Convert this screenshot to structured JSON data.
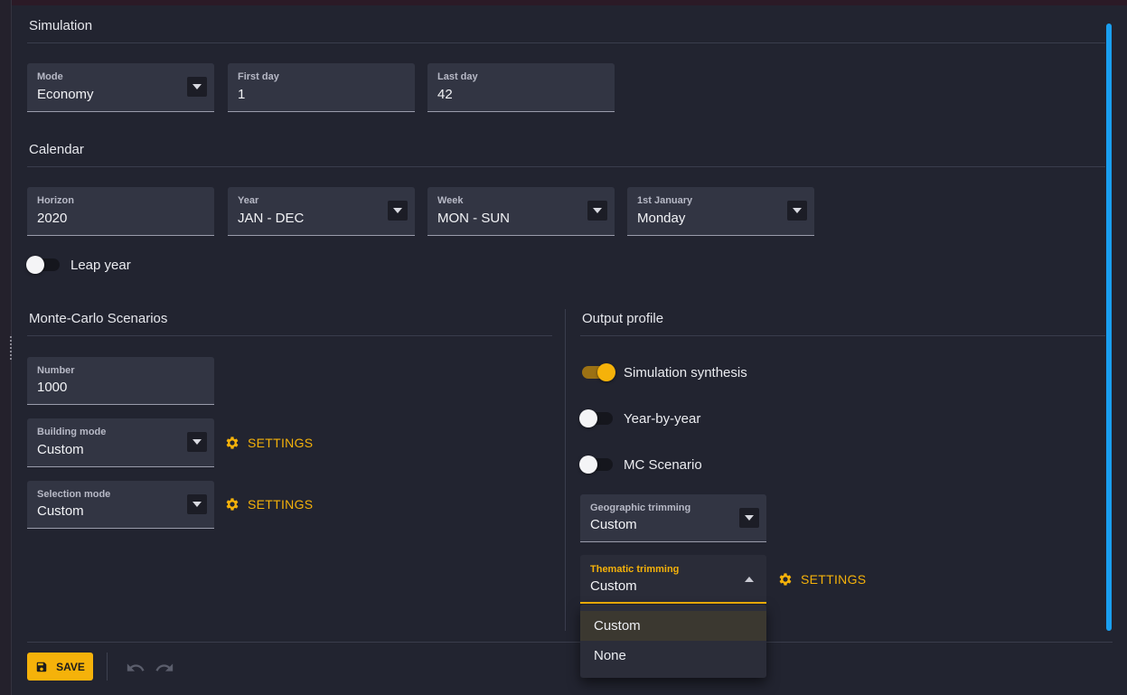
{
  "simulation": {
    "title": "Simulation",
    "mode": {
      "label": "Mode",
      "value": "Economy"
    },
    "first_day": {
      "label": "First day",
      "value": "1"
    },
    "last_day": {
      "label": "Last day",
      "value": "42"
    }
  },
  "calendar": {
    "title": "Calendar",
    "horizon": {
      "label": "Horizon",
      "value": "2020"
    },
    "year": {
      "label": "Year",
      "value": "JAN - DEC"
    },
    "week": {
      "label": "Week",
      "value": "MON - SUN"
    },
    "first_january": {
      "label": "1st January",
      "value": "Monday"
    },
    "leap_year": {
      "label": "Leap year",
      "checked": false
    }
  },
  "monte_carlo": {
    "title": "Monte-Carlo Scenarios",
    "number": {
      "label": "Number",
      "value": "1000"
    },
    "building_mode": {
      "label": "Building mode",
      "value": "Custom"
    },
    "selection_mode": {
      "label": "Selection mode",
      "value": "Custom"
    },
    "settings_label": "SETTINGS"
  },
  "output_profile": {
    "title": "Output profile",
    "simulation_synthesis": {
      "label": "Simulation synthesis",
      "checked": true
    },
    "year_by_year": {
      "label": "Year-by-year",
      "checked": false
    },
    "mc_scenario": {
      "label": "MC Scenario",
      "checked": false
    },
    "geographic_trimming": {
      "label": "Geographic trimming",
      "value": "Custom"
    },
    "thematic_trimming": {
      "label": "Thematic trimming",
      "value": "Custom"
    },
    "settings_label": "SETTINGS",
    "dropdown_options": [
      "Custom",
      "None"
    ],
    "dropdown_highlighted": "Custom"
  },
  "footer": {
    "save_label": "SAVE"
  },
  "colors": {
    "accent": "#f5b20a",
    "scrollbar": "#1a9ff0",
    "background": "#222430",
    "field": "#323543"
  },
  "icons": {
    "gear": "gear-icon",
    "save": "save-icon",
    "undo": "undo-icon",
    "redo": "redo-icon",
    "dropdown": "chevron-down-icon"
  }
}
